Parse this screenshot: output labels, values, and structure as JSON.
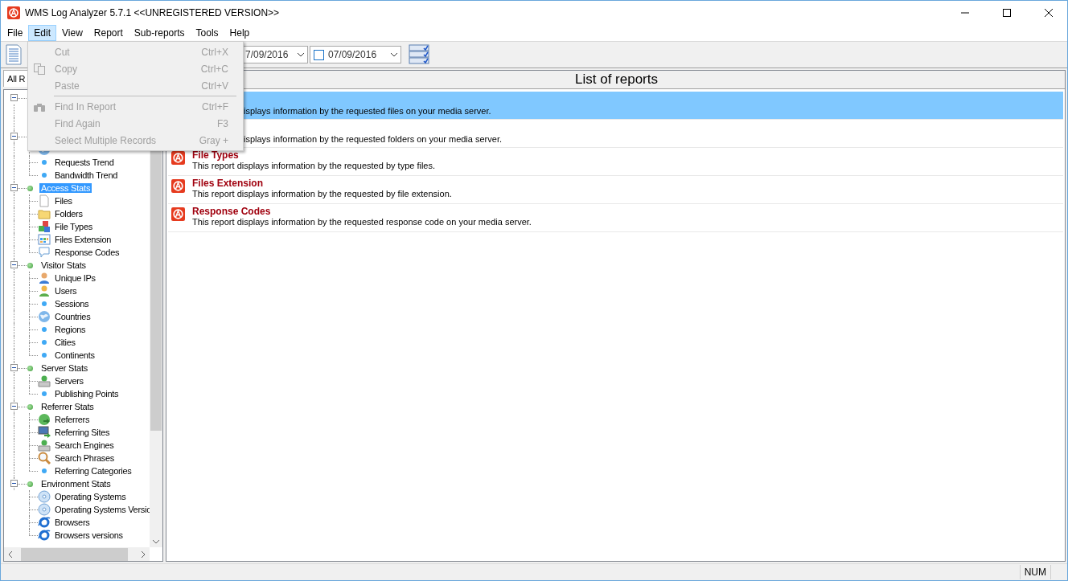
{
  "window": {
    "title": "WMS Log Analyzer 5.7.1 <<UNREGISTERED VERSION>>"
  },
  "menu_bar": [
    {
      "label": "File",
      "selected": false
    },
    {
      "label": "Edit",
      "selected": true
    },
    {
      "label": "View",
      "selected": false
    },
    {
      "label": "Report",
      "selected": false
    },
    {
      "label": "Sub-reports",
      "selected": false
    },
    {
      "label": "Tools",
      "selected": false
    },
    {
      "label": "Help",
      "selected": false
    }
  ],
  "edit_menu": {
    "items": [
      {
        "kind": "plain",
        "label": "Cut",
        "shortcut": "Ctrl+X",
        "disabled": true
      },
      {
        "kind": "copy",
        "label": "Copy",
        "shortcut": "Ctrl+C",
        "disabled": true
      },
      {
        "kind": "plain",
        "label": "Paste",
        "shortcut": "Ctrl+V",
        "disabled": true
      },
      {
        "kind": "separator"
      },
      {
        "kind": "find",
        "label": "Find In Report",
        "shortcut": "Ctrl+F",
        "disabled": true
      },
      {
        "kind": "plain",
        "label": "Find Again",
        "shortcut": "F3",
        "disabled": true
      },
      {
        "kind": "plain",
        "label": "Select Multiple Records",
        "shortcut": "Gray +",
        "disabled": true
      }
    ]
  },
  "toolbar": {
    "date_from": "7/09/2016",
    "date_to": "07/09/2016",
    "date_to_checked": false
  },
  "left_tab": {
    "label": "All R"
  },
  "tree": [
    {
      "expanded": true,
      "children": [
        {
          "kind": "blank"
        },
        {
          "kind": "blank"
        }
      ]
    },
    {
      "expanded": true,
      "children": [
        {
          "kind": "globe"
        },
        {
          "label": "Requests Trend",
          "kind": "dot",
          "selected": false
        },
        {
          "label": "Bandwidth Trend",
          "kind": "dot",
          "selected": false
        }
      ]
    },
    {
      "label": "Access Stats",
      "expanded": true,
      "selected": true,
      "children": [
        {
          "label": "Files",
          "kind": "doc",
          "selected": false
        },
        {
          "label": "Folders",
          "kind": "folder",
          "selected": false
        },
        {
          "label": "File Types",
          "kind": "cubes",
          "selected": false
        },
        {
          "label": "Files Extension",
          "kind": "grid",
          "selected": false
        },
        {
          "label": "Response Codes",
          "kind": "bubble",
          "selected": false
        }
      ]
    },
    {
      "label": "Visitor Stats",
      "expanded": true,
      "selected": false,
      "children": [
        {
          "label": "Unique IPs",
          "kind": "person",
          "selected": false
        },
        {
          "label": "Users",
          "kind": "user",
          "selected": false
        },
        {
          "label": "Sessions",
          "kind": "dot",
          "selected": false
        },
        {
          "label": "Countries",
          "kind": "globe",
          "selected": false
        },
        {
          "label": "Regions",
          "kind": "dot",
          "selected": false
        },
        {
          "label": "Cities",
          "kind": "dot",
          "selected": false
        },
        {
          "label": "Continents",
          "kind": "dot",
          "selected": false
        }
      ]
    },
    {
      "label": "Server Stats",
      "expanded": true,
      "selected": false,
      "children": [
        {
          "label": "Servers",
          "kind": "server",
          "selected": false
        },
        {
          "label": "Publishing Points",
          "kind": "dot",
          "selected": false
        }
      ]
    },
    {
      "label": "Referrer Stats",
      "expanded": true,
      "selected": false,
      "children": [
        {
          "label": "Referrers",
          "kind": "globearrow",
          "selected": false
        },
        {
          "label": "Referring Sites",
          "kind": "monitor",
          "selected": false
        },
        {
          "label": "Search Engines",
          "kind": "server",
          "selected": false
        },
        {
          "label": "Search Phrases",
          "kind": "magnifier",
          "selected": false
        },
        {
          "label": "Referring Categories",
          "kind": "dot",
          "selected": false
        }
      ]
    },
    {
      "label": "Environment Stats",
      "expanded": true,
      "selected": false,
      "children": [
        {
          "label": "Operating Systems",
          "kind": "disc",
          "selected": false
        },
        {
          "label": "Operating Systems Versic",
          "kind": "disc",
          "selected": false
        },
        {
          "label": "Browsers",
          "kind": "ring",
          "selected": false
        },
        {
          "label": "Browsers versions",
          "kind": "ring",
          "selected": false
        }
      ]
    }
  ],
  "reports_panel": {
    "title": "List of reports",
    "reports": [
      {
        "kind": "partial",
        "description": "isplays information by the requested files on your media server.",
        "selected": true
      },
      {
        "kind": "partial",
        "description": "isplays information by the requested folders on your media server.",
        "selected": false
      },
      {
        "kind": "full",
        "title": "File Types",
        "description": "This report displays information by the requested by type files.",
        "selected": false
      },
      {
        "kind": "full",
        "title": "Files Extension",
        "description": "This report displays information by the requested by file extension.",
        "selected": false
      },
      {
        "kind": "full",
        "title": "Response Codes",
        "description": "This report displays information by the requested response code on your media server.",
        "selected": false
      }
    ]
  },
  "status_bar": {
    "indicator": "NUM"
  }
}
